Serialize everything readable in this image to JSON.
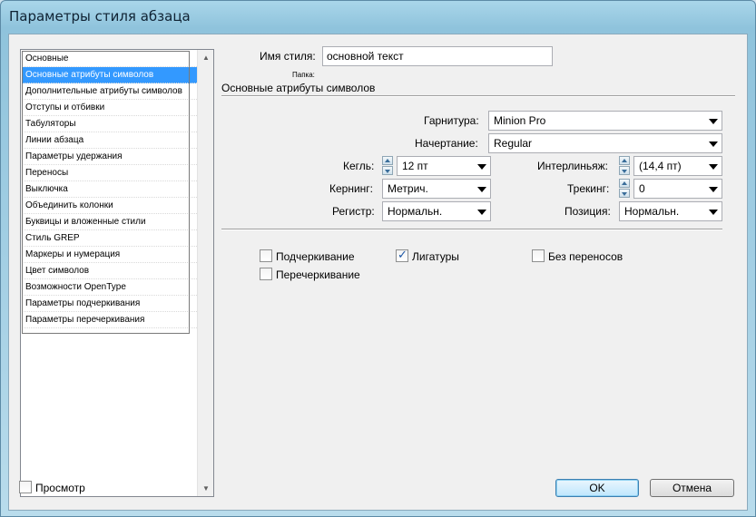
{
  "window": {
    "title": "Параметры стиля абзаца"
  },
  "sidebar": {
    "items": [
      {
        "label": "Основные",
        "selected": false
      },
      {
        "label": "Основные атрибуты символов",
        "selected": true
      },
      {
        "label": "Дополнительные атрибуты символов",
        "selected": false
      },
      {
        "label": "Отступы и отбивки",
        "selected": false
      },
      {
        "label": "Табуляторы",
        "selected": false
      },
      {
        "label": "Линии абзаца",
        "selected": false
      },
      {
        "label": "Параметры удержания",
        "selected": false
      },
      {
        "label": "Переносы",
        "selected": false
      },
      {
        "label": "Выключка",
        "selected": false
      },
      {
        "label": "Объединить колонки",
        "selected": false
      },
      {
        "label": "Буквицы и вложенные стили",
        "selected": false
      },
      {
        "label": "Стиль GREP",
        "selected": false
      },
      {
        "label": "Маркеры и нумерация",
        "selected": false
      },
      {
        "label": "Цвет символов",
        "selected": false
      },
      {
        "label": "Возможности OpenType",
        "selected": false
      },
      {
        "label": "Параметры подчеркивания",
        "selected": false
      },
      {
        "label": "Параметры перечеркивания",
        "selected": false
      }
    ],
    "scroll_up": "▲",
    "scroll_down": "▼"
  },
  "style": {
    "name_label": "Имя стиля:",
    "name_value": "основной текст",
    "folder_label": "Папка:",
    "section_title": "Основные атрибуты символов"
  },
  "fields": {
    "font_family_label": "Гарнитура:",
    "font_family_value": "Minion Pro",
    "font_style_label": "Начертание:",
    "font_style_value": "Regular",
    "size_label": "Кегль:",
    "size_value": "12 пт",
    "leading_label": "Интерлиньяж:",
    "leading_value": "(14,4 пт)",
    "kerning_label": "Кернинг:",
    "kerning_value": "Метрич.",
    "tracking_label": "Трекинг:",
    "tracking_value": "0",
    "case_label": "Регистр:",
    "case_value": "Нормальн.",
    "position_label": "Позиция:",
    "position_value": "Нормальн."
  },
  "checks": {
    "underline_label": "Подчеркивание",
    "underline_checked": false,
    "ligatures_label": "Лигатуры",
    "ligatures_checked": true,
    "nobreak_label": "Без переносов",
    "nobreak_checked": false,
    "strikethrough_label": "Перечеркивание",
    "strikethrough_checked": false
  },
  "footer": {
    "preview_label": "Просмотр",
    "preview_checked": false,
    "ok_label": "OK",
    "cancel_label": "Отмена"
  }
}
